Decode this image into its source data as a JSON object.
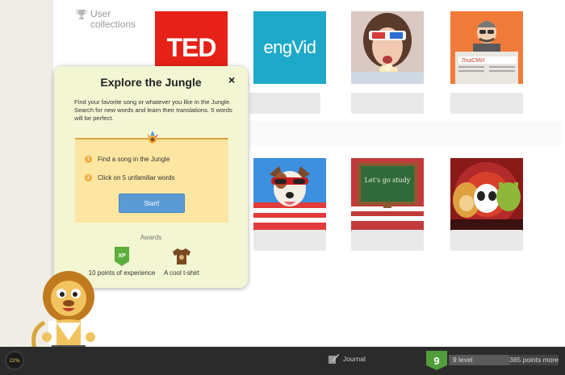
{
  "sidebar": {
    "user_collections_label": "User collections",
    "trophy_icon": "trophy-icon"
  },
  "collections": [
    {
      "name": "TED",
      "logo_text": "TED",
      "color": "#e62117"
    },
    {
      "name": "engVid",
      "logo_text": "engVid",
      "color": "#1ea9c9"
    },
    {
      "name": "3D glasses girl",
      "icon": "popcorn-girl-image"
    },
    {
      "name": "news reader",
      "icon": "newspaper-man-image",
      "newspaper_text": "ЛпаСМИ"
    },
    {
      "name": "dog with sunglasses",
      "icon": "dog-image"
    },
    {
      "name": "chalkboard",
      "icon": "chalkboard-image",
      "board_text": "Let's go study"
    },
    {
      "name": "cartoon characters",
      "icon": "cartoon-image"
    }
  ],
  "popup": {
    "title": "Explore the Jungle",
    "close_label": "×",
    "description": "Find your favorite song or whatever you like in the Jungle. Search for new words and learn their translations. 5 words will be perfect.",
    "steps": [
      {
        "num": "1",
        "text": "Find a song in the Jungle"
      },
      {
        "num": "2",
        "text": "Click on 5 unfamiliar words"
      }
    ],
    "start_label": "Start!",
    "awards_label": "Awards",
    "awards": [
      {
        "badge": "XP",
        "caption": "10 points of experience",
        "icon": "xp-badge-icon",
        "color": "#5cae3c"
      },
      {
        "caption": "A cool t-shirt",
        "icon": "tshirt-icon",
        "color": "#7a4a22"
      }
    ]
  },
  "bottom_bar": {
    "progress_text": "22%",
    "journal_label": "Journal",
    "level_number": "9",
    "level_text": "9 level",
    "points_text": "385 points more",
    "level_fraction": 0.55,
    "colors": {
      "bar": "#2b2b2b",
      "level": "#4f9d3b",
      "progress": "#e8c94a"
    }
  }
}
